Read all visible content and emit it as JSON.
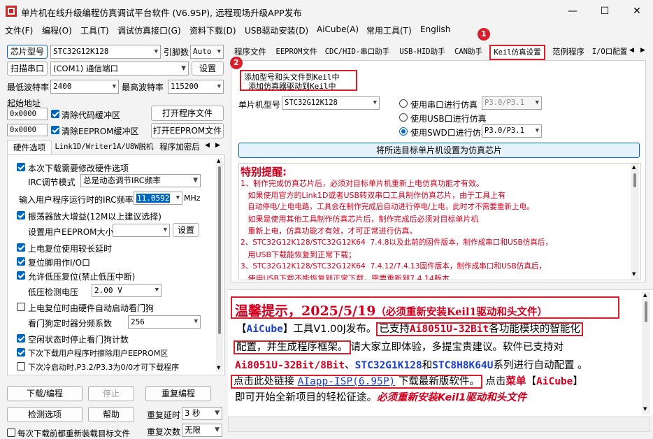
{
  "window": {
    "title": "单片机在线升级编程仿真调试平台软件 (V6.95P), 远程现场升级APP发布",
    "minimize": "—",
    "maximize": "☐",
    "close": "✕"
  },
  "menu": [
    "文件(F)",
    "编程(O)",
    "工具(T)",
    "调试仿真接口(G)",
    "资料下载(D)",
    "USB驱动安装(D)",
    "AiCube(A)",
    "常用工具(T)",
    "English"
  ],
  "left": {
    "chip_btn": "芯片型号",
    "chip_value": "STC32G12K128",
    "pin_label": "引脚数",
    "pin_value": "Auto",
    "scan_btn": "扫描串口",
    "port_value": "(COM1) 通信端口",
    "settings_btn": "设置",
    "min_baud_label": "最低波特率",
    "min_baud": "2400",
    "max_baud_label": "最高波特率",
    "max_baud": "115200",
    "start_addr_label": "起始地址",
    "addr1": "0x0000",
    "clear_code": "清除代码缓冲区",
    "open_prog": "打开程序文件",
    "addr2": "0x0000",
    "clear_eeprom": "清除EEPROM缓冲区",
    "open_eeprom": "打开EEPROM文件",
    "tabs": [
      "硬件选项",
      "Link1D/Writer1A/U8W脱机",
      "程序加密后"
    ],
    "hw": {
      "opt1": "本次下载需要修改硬件选项",
      "irc_label": "IRC调节模式",
      "irc_mode": "总是动态调节IRC频率",
      "freq_label": "输入用户程序运行时的IRC频率",
      "freq_value": "11.0592",
      "freq_unit": "MHz",
      "osc": "振荡器放大增益(12M以上建议选择)",
      "eeprom_size_label": "设置用户EEPROM大小",
      "eeprom_size": "1   K",
      "eeprom_set": "设置",
      "por_delay": "上电复位使用较长延时",
      "reset_io": "复位脚用作I/O口",
      "lvr": "允许低压复位(禁止低压中断)",
      "lvd_label": "低压检测电压",
      "lvd_value": "2.00 V",
      "wdt_auto": "上电复位时由硬件自动启动看门狗",
      "wdt_div_label": "看门狗定时器分频系数",
      "wdt_div": "256",
      "idle_wdt": "空闲状态时停止看门狗计数",
      "erase_eeprom": "下次下载用户程序时擦除用户EEPROM区",
      "cold_boot": "下次冷启动时,P3.2/P3.3为0/0才可下载程序"
    },
    "download_btn": "下载/编程",
    "stop_btn": "停止",
    "reprog_btn": "重复编程",
    "check_btn": "检测选项",
    "help_btn": "帮助",
    "repeat_delay_label": "重复延时",
    "repeat_delay": "3 秒",
    "repeat_count_label": "重复次数",
    "repeat_count": "无限",
    "reload_label": "每次下载前都重新装载目标文件"
  },
  "right": {
    "tabs": [
      "程序文件",
      "EEPROM文件",
      "CDC/HID-串口助手",
      "USB-HID助手",
      "CAN助手",
      "Keil仿真设置",
      "范例程序",
      "I/O口配置"
    ],
    "badge1": "1",
    "badge2": "2",
    "add_model": "添加型号和头文件到Keil中",
    "add_emu": "添加仿真器驱动到Keil中",
    "mcu_label": "单片机型号",
    "mcu_value": "STC32G12K128",
    "r_serial": "使用串口进行仿真",
    "r_serial_val": "P3.0/P3.1",
    "r_usb": "使用USB口进行仿真",
    "r_swd": "使用SWD口进行仿真",
    "r_swd_val": "P3.0/P3.1",
    "set_emu_btn": "将所选目标单片机设置为仿真芯片",
    "notice_title": "特别提醒:",
    "notice_lines": [
      "1、制作完成仿真芯片后，必须对目标单片机重新上电仿真功能才有效。",
      "   如果使用官方的Link1D或者USB转双串口工具制作仿真芯片，由于工具上有",
      "   自动停电/上电电路，工具会在制作完成后自动进行停电/上电，此时才不需要重新上电。",
      "   如果是使用其他工具制作仿真芯片后，制作完成后必须对目标单片机",
      "   重新上电，仿真功能才有效，才可正常进行仿真。",
      "2、STC32G12K128/STC32G12K64  7.4.8以及此前的固件版本，制作成串口和USB仿真后，",
      "   用USB下载能恢复到正常下载；",
      "3、STC32G12K128/STC32G12K64  7.4.12/7.4.13固件版本，制作成串口和USB仿真后，",
      "   使用USB下载不能恢复到正常下载，需要重新到7.4.14版本"
    ],
    "tip": {
      "headline_a": "温馨提示，2025/5/19",
      "headline_b": "（必须重新安装Keil1驱动和头文件）",
      "l2_a": "【",
      "l2_b": "AiCube",
      "l2_c": "】工具V1.00J发布。",
      "l2_d": "已支持",
      "l2_e": "Ai8051U-32Bit",
      "l2_f": "各功能模块的智能化",
      "l3_a": "配置，并生成程序框架。",
      "l3_b": "请大家立即体验，多提宝贵建议。软件已支持对",
      "l4_a": "Ai8051U-32Bit/8Bit",
      "l4_b": "、",
      "l4_c": "STC32G1K128",
      "l4_d": "和",
      "l4_e": "STC8H8K64U",
      "l4_f": "系列进行自动配置 。",
      "l5_a": "点击此处链接 ",
      "l5_b": "AIapp-ISP(6.95P)",
      "l5_c": " 下载最新版软件。",
      "l5_d": "点击",
      "l5_e": "菜单",
      "l5_f": "【",
      "l5_g": "AiCube",
      "l5_h": "】",
      "l6_a": "即可开始全新项目的轻松征途。",
      "l6_b": "必须重新安装Keil1驱动和头文件"
    }
  },
  "colors": {
    "red": "#d91e2c",
    "blue": "#0067c0",
    "link": "#1a3fcf"
  }
}
